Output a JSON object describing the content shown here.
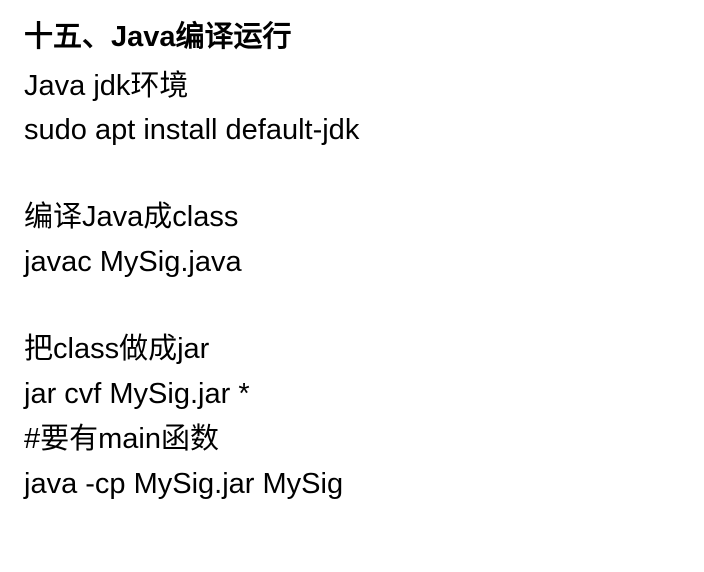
{
  "heading": "十五、Java编译运行",
  "block1_line1": "Java jdk环境",
  "block1_line2": "sudo apt install default-jdk",
  "block2_line1": "编译Java成class",
  "block2_line2": "javac MySig.java",
  "block3_line1": "把class做成jar",
  "block3_line2": "jar cvf MySig.jar *",
  "block3_line3": "#要有main函数",
  "block3_line4": "java -cp MySig.jar MySig"
}
